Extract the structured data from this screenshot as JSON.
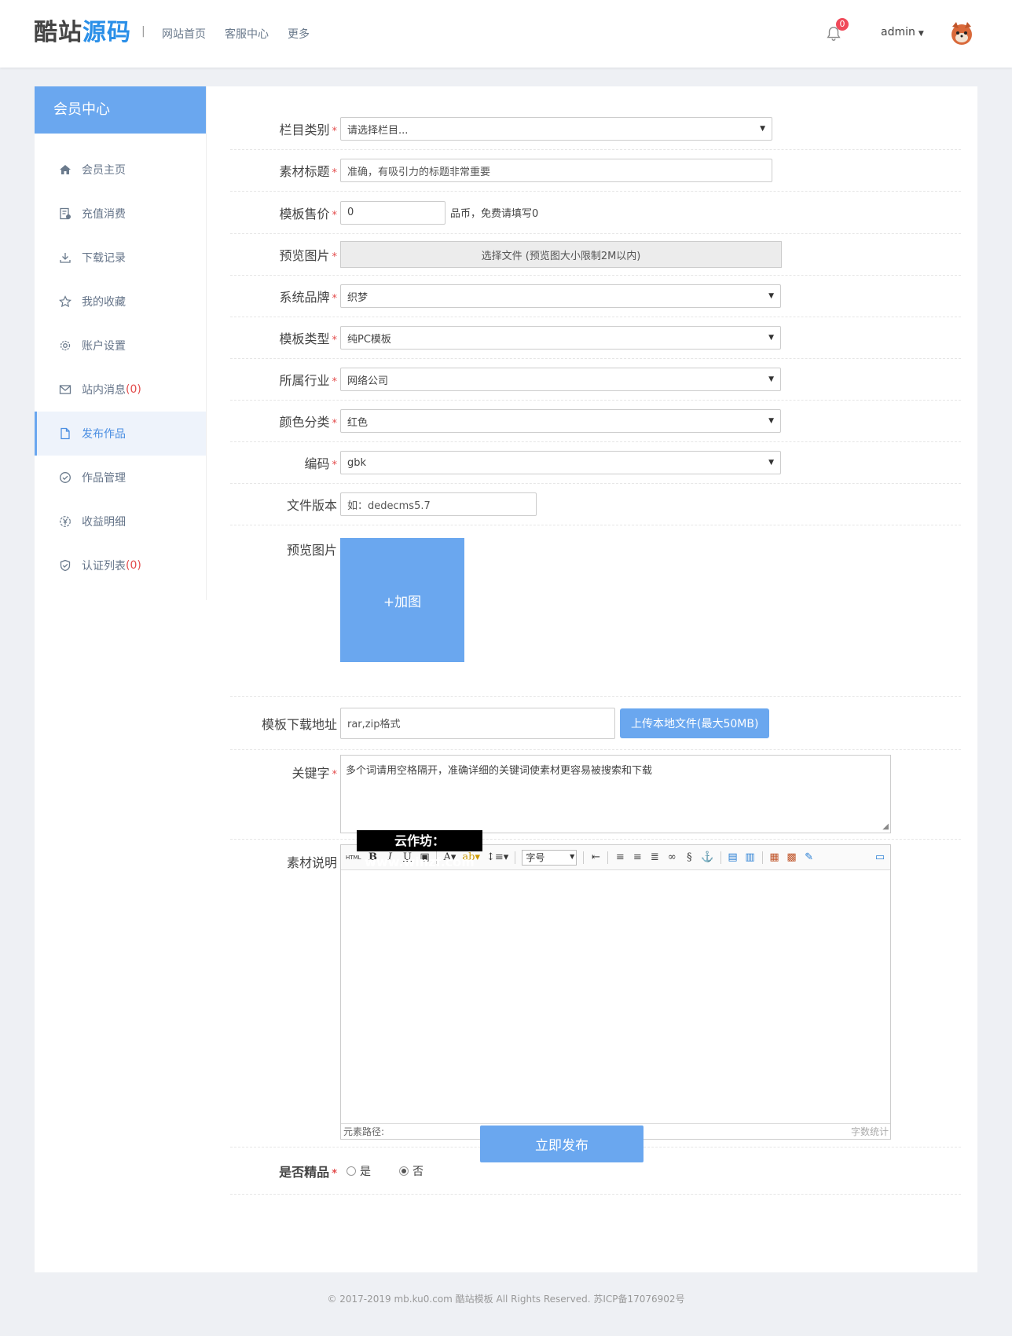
{
  "header": {
    "logo_part1": "酷站",
    "logo_part2": "源码",
    "separator": "|",
    "nav": [
      "网站首页",
      "客服中心",
      "更多"
    ],
    "notification_count": "0",
    "user": "admin"
  },
  "sidebar": {
    "title": "会员中心",
    "items": [
      {
        "label": "会员主页",
        "count": ""
      },
      {
        "label": "充值消费",
        "count": ""
      },
      {
        "label": "下载记录",
        "count": ""
      },
      {
        "label": "我的收藏",
        "count": ""
      },
      {
        "label": "账户设置",
        "count": ""
      },
      {
        "label": "站内消息",
        "count": "(0)"
      },
      {
        "label": "发布作品",
        "count": ""
      },
      {
        "label": "作品管理",
        "count": ""
      },
      {
        "label": "收益明细",
        "count": ""
      },
      {
        "label": "认证列表",
        "count": "(0)"
      }
    ]
  },
  "form": {
    "category": {
      "label": "栏目类别",
      "value": "请选择栏目..."
    },
    "title": {
      "label": "素材标题",
      "placeholder": "准确，有吸引力的标题非常重要"
    },
    "price": {
      "label": "模板售价",
      "value": "0",
      "hint": "品币，免费请填写0"
    },
    "preview_file": {
      "label": "预览图片",
      "button": "选择文件 (预览图大小限制2M以内)"
    },
    "brand": {
      "label": "系统品牌",
      "value": "织梦"
    },
    "template_type": {
      "label": "模板类型",
      "value": "纯PC模板"
    },
    "industry": {
      "label": "所属行业",
      "value": "网络公司"
    },
    "color": {
      "label": "颜色分类",
      "value": "红色"
    },
    "encoding": {
      "label": "编码",
      "value": "gbk"
    },
    "version": {
      "label": "文件版本",
      "placeholder": "如：dedecms5.7"
    },
    "preview_images": {
      "label": "预览图片",
      "add": "+加图"
    },
    "download": {
      "label": "模板下载地址",
      "placeholder": "rar,zip格式",
      "upload": "上传本地文件(最大50MB)"
    },
    "keywords": {
      "label": "关键字",
      "placeholder": "多个词请用空格隔开，准确详细的关键词使素材更容易被搜索和下载"
    },
    "description": {
      "label": "素材说明",
      "font_size": "字号",
      "status_left": "元素路径:",
      "status_right": "字数统计"
    },
    "featured": {
      "label": "是否精品",
      "yes": "是",
      "no": "否"
    },
    "submit": "立即发布"
  },
  "watermark": "云作坊：www.winzf.com",
  "footer": "© 2017-2019 mb.ku0.com 酷站模板 All Rights Reserved. 苏ICP备17076902号",
  "colors": {
    "accent": "#6aa7ef",
    "required": "#e34b4b",
    "badge": "#f04a5a"
  }
}
